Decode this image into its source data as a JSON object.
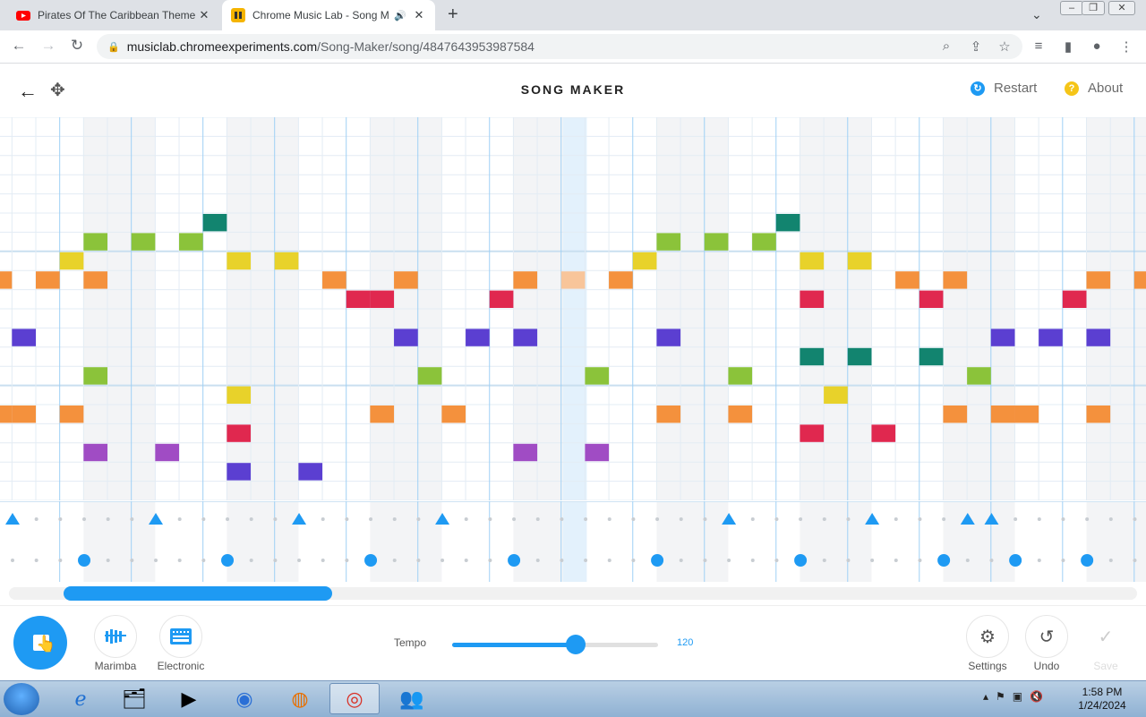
{
  "browser": {
    "tabs": [
      {
        "title": "Pirates Of The Caribbean Theme",
        "close": "✕"
      },
      {
        "title": "Chrome Music Lab - Song M",
        "close": "✕"
      }
    ],
    "new_tab": "+",
    "url_host": "musiclab.chromeexperiments.com",
    "url_path": "/Song-Maker/song/4847643953987584"
  },
  "app": {
    "title": "SONG MAKER",
    "restart_label": "Restart",
    "about_label": "About"
  },
  "grid": {
    "columns": 48,
    "rows": 20,
    "notes": [
      {
        "col": 0,
        "row": 8,
        "color": "#f4913d"
      },
      {
        "col": 2,
        "row": 8,
        "color": "#f4913d"
      },
      {
        "col": 4,
        "row": 8,
        "color": "#f4913d"
      },
      {
        "col": 0,
        "row": 15,
        "color": "#f4913d"
      },
      {
        "col": 1,
        "row": 15,
        "color": "#f4913d"
      },
      {
        "col": 3,
        "row": 15,
        "color": "#f4913d"
      },
      {
        "col": 1,
        "row": 11,
        "color": "#5b3fd1"
      },
      {
        "col": 3,
        "row": 7,
        "color": "#e8d22a"
      },
      {
        "col": 4,
        "row": 6,
        "color": "#8bc33a"
      },
      {
        "col": 4,
        "row": 13,
        "color": "#8bc33a"
      },
      {
        "col": 4,
        "row": 17,
        "color": "#a04cc4"
      },
      {
        "col": 6,
        "row": 6,
        "color": "#8bc33a"
      },
      {
        "col": 7,
        "row": 17,
        "color": "#a04cc4"
      },
      {
        "col": 8,
        "row": 6,
        "color": "#8bc33a"
      },
      {
        "col": 9,
        "row": 5,
        "color": "#12846f"
      },
      {
        "col": 10,
        "row": 7,
        "color": "#e8d22a"
      },
      {
        "col": 10,
        "row": 14,
        "color": "#e8d22a"
      },
      {
        "col": 10,
        "row": 16,
        "color": "#e0284f"
      },
      {
        "col": 10,
        "row": 18,
        "color": "#5b3fd1"
      },
      {
        "col": 12,
        "row": 7,
        "color": "#e8d22a"
      },
      {
        "col": 13,
        "row": 18,
        "color": "#5b3fd1"
      },
      {
        "col": 14,
        "row": 8,
        "color": "#f4913d"
      },
      {
        "col": 15,
        "row": 9,
        "color": "#e0284f"
      },
      {
        "col": 16,
        "row": 9,
        "color": "#e0284f"
      },
      {
        "col": 16,
        "row": 15,
        "color": "#f4913d"
      },
      {
        "col": 17,
        "row": 8,
        "color": "#f4913d"
      },
      {
        "col": 17,
        "row": 11,
        "color": "#5b3fd1"
      },
      {
        "col": 18,
        "row": 13,
        "color": "#8bc33a"
      },
      {
        "col": 19,
        "row": 15,
        "color": "#f4913d"
      },
      {
        "col": 20,
        "row": 11,
        "color": "#5b3fd1"
      },
      {
        "col": 21,
        "row": 9,
        "color": "#e0284f"
      },
      {
        "col": 22,
        "row": 8,
        "color": "#f4913d"
      },
      {
        "col": 22,
        "row": 11,
        "color": "#5b3fd1"
      },
      {
        "col": 22,
        "row": 17,
        "color": "#a04cc4"
      },
      {
        "col": 24,
        "row": 8,
        "color": "#f8c59a"
      },
      {
        "col": 25,
        "row": 13,
        "color": "#8bc33a"
      },
      {
        "col": 25,
        "row": 17,
        "color": "#a04cc4"
      },
      {
        "col": 26,
        "row": 8,
        "color": "#f4913d"
      },
      {
        "col": 27,
        "row": 7,
        "color": "#e8d22a"
      },
      {
        "col": 28,
        "row": 6,
        "color": "#8bc33a"
      },
      {
        "col": 28,
        "row": 11,
        "color": "#5b3fd1"
      },
      {
        "col": 28,
        "row": 15,
        "color": "#f4913d"
      },
      {
        "col": 30,
        "row": 6,
        "color": "#8bc33a"
      },
      {
        "col": 31,
        "row": 13,
        "color": "#8bc33a"
      },
      {
        "col": 31,
        "row": 15,
        "color": "#f4913d"
      },
      {
        "col": 32,
        "row": 6,
        "color": "#8bc33a"
      },
      {
        "col": 33,
        "row": 5,
        "color": "#12846f"
      },
      {
        "col": 34,
        "row": 7,
        "color": "#e8d22a"
      },
      {
        "col": 34,
        "row": 9,
        "color": "#e0284f"
      },
      {
        "col": 34,
        "row": 12,
        "color": "#12846f"
      },
      {
        "col": 34,
        "row": 16,
        "color": "#e0284f"
      },
      {
        "col": 35,
        "row": 14,
        "color": "#e8d22a"
      },
      {
        "col": 36,
        "row": 7,
        "color": "#e8d22a"
      },
      {
        "col": 36,
        "row": 12,
        "color": "#12846f"
      },
      {
        "col": 37,
        "row": 16,
        "color": "#e0284f"
      },
      {
        "col": 38,
        "row": 8,
        "color": "#f4913d"
      },
      {
        "col": 39,
        "row": 9,
        "color": "#e0284f"
      },
      {
        "col": 39,
        "row": 12,
        "color": "#12846f"
      },
      {
        "col": 40,
        "row": 8,
        "color": "#f4913d"
      },
      {
        "col": 40,
        "row": 15,
        "color": "#f4913d"
      },
      {
        "col": 41,
        "row": 13,
        "color": "#8bc33a"
      },
      {
        "col": 42,
        "row": 11,
        "color": "#5b3fd1"
      },
      {
        "col": 42,
        "row": 15,
        "color": "#f4913d"
      },
      {
        "col": 43,
        "row": 15,
        "color": "#f4913d"
      },
      {
        "col": 44,
        "row": 11,
        "color": "#5b3fd1"
      },
      {
        "col": 45,
        "row": 9,
        "color": "#e0284f"
      },
      {
        "col": 46,
        "row": 8,
        "color": "#f4913d"
      },
      {
        "col": 46,
        "row": 11,
        "color": "#5b3fd1"
      },
      {
        "col": 46,
        "row": 15,
        "color": "#f4913d"
      },
      {
        "col": 48,
        "row": 8,
        "color": "#f4913d"
      }
    ],
    "playhead_col": 24
  },
  "percussion": {
    "triangles": [
      0,
      6,
      12,
      18,
      30,
      36,
      40,
      41
    ],
    "circles": [
      3,
      9,
      15,
      21,
      27,
      33,
      39,
      42,
      45
    ]
  },
  "scroll": {
    "position": 0.05,
    "visible_fraction": 0.24
  },
  "controls": {
    "instrument1_label": "Marimba",
    "instrument2_label": "Electronic",
    "tempo_label": "Tempo",
    "tempo_value": "120",
    "tempo_fraction": 0.6,
    "settings_label": "Settings",
    "undo_label": "Undo",
    "save_label": "Save"
  },
  "taskbar": {
    "time": "1:58 PM",
    "date": "1/24/2024"
  },
  "colors": {
    "accent": "#1e9af3"
  }
}
